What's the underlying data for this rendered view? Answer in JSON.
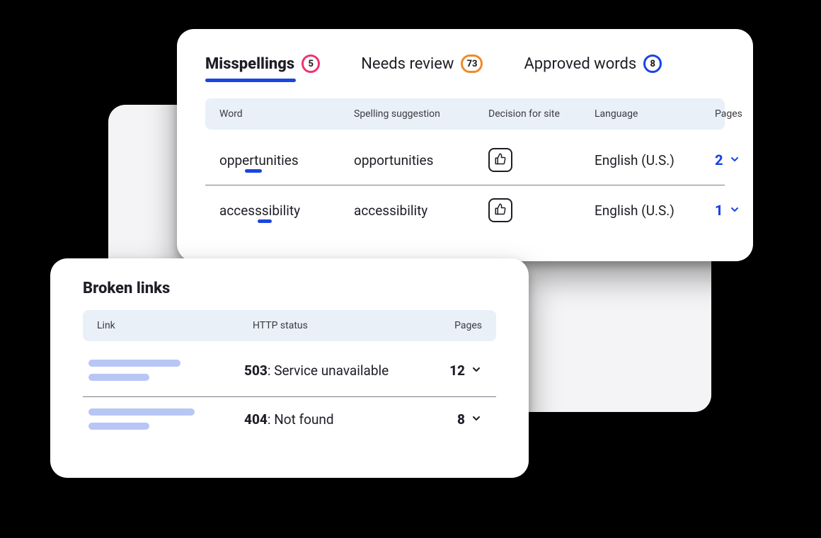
{
  "spell": {
    "tabs": [
      {
        "label": "Misspellings",
        "count": "5",
        "badge": "pink",
        "active": true
      },
      {
        "label": "Needs review",
        "count": "73",
        "badge": "orange",
        "active": false
      },
      {
        "label": "Approved words",
        "count": "8",
        "badge": "blue",
        "active": false
      }
    ],
    "columns": {
      "word": "Word",
      "suggestion": "Spelling suggestion",
      "decision": "Decision for site",
      "language": "Language",
      "pages": "Pages"
    },
    "rows": [
      {
        "word": "oppertunities",
        "suggestion": "opportunities",
        "language": "English (U.S.)",
        "pages": "2"
      },
      {
        "word": "accesssibility",
        "suggestion": "accessibility",
        "language": "English (U.S.)",
        "pages": "1"
      }
    ]
  },
  "broken": {
    "title": "Broken links",
    "columns": {
      "link": "Link",
      "http": "HTTP status",
      "pages": "Pages"
    },
    "rows": [
      {
        "code": "503",
        "status": ": Service unavailable",
        "pages": "12"
      },
      {
        "code": "404",
        "status": ": Not found",
        "pages": "8"
      }
    ]
  }
}
